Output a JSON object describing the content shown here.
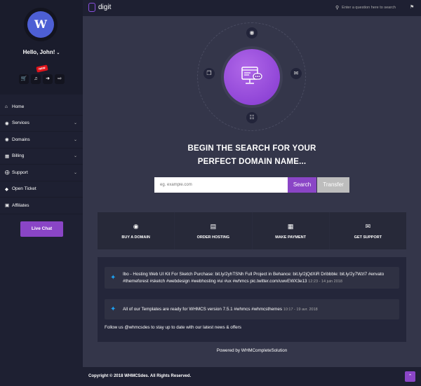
{
  "brand": {
    "logo_text": "digit",
    "accent": "#8a45c6"
  },
  "user": {
    "avatar_letter": "W",
    "greeting": "Hello, John!"
  },
  "quick_icons": [
    {
      "icon": "cart-icon"
    },
    {
      "icon": "bell-icon"
    },
    {
      "icon": "arrow-right-icon"
    },
    {
      "icon": "logout-icon"
    }
  ],
  "new_badge": "new",
  "sidebar": {
    "items": [
      {
        "label": "Home",
        "icon": "home-icon",
        "has_submenu": false
      },
      {
        "label": "Services",
        "icon": "cube-icon",
        "has_submenu": true
      },
      {
        "label": "Domains",
        "icon": "globe-icon",
        "has_submenu": true
      },
      {
        "label": "Billing",
        "icon": "card-icon",
        "has_submenu": true
      },
      {
        "label": "Support",
        "icon": "lifebuoy-icon",
        "has_submenu": true
      },
      {
        "label": "Open Ticket",
        "icon": "tag-icon",
        "has_submenu": false
      },
      {
        "label": "Affiliates",
        "icon": "affiliate-icon",
        "has_submenu": false
      }
    ],
    "live_chat": "Live Chat"
  },
  "topbar": {
    "search_placeholder": "Enter a question here to search"
  },
  "hero": {
    "headline_line1": "BEGIN THE SEARCH FOR YOUR",
    "headline_line2": "PERFECT DOMAIN NAME..."
  },
  "domain_search": {
    "placeholder": "eg. example.com",
    "search_label": "Search",
    "transfer_label": "Transfer"
  },
  "actions": [
    {
      "label": "BUY A DOMAIN",
      "icon": "globe-icon"
    },
    {
      "label": "ORDER HOSTING",
      "icon": "server-icon"
    },
    {
      "label": "MAKE PAYMENT",
      "icon": "card-icon"
    },
    {
      "label": "GET SUPPORT",
      "icon": "envelope-icon"
    }
  ],
  "tweets": [
    {
      "text": "Ibo - Hosting Web UI Kit For Sketch Purchase: bit.ly/2yhTSNh Full Project in Behance: bit.ly/2jQdXiR Dribbble: bit.ly/2y7Wzl7 #envato #themeforest #sketch #webdesign #webhosting #ui #ux #whmcs pic.twitter.com/uwvEWX3e13",
      "date": "12:23 - 14 juin 2018"
    },
    {
      "text": "All of our Templates are ready for WHMCS version 7.5.1 #whmcs #whmcsthemes",
      "date": "10:17 - 19 avr. 2018"
    }
  ],
  "follow_text": "Follow us @whmcsdes to stay up to date with our latest news & offers",
  "powered_by": "Powered by WHMCompleteSolution",
  "copyright": "Copyright © 2018 WHMCSdes. All Rights Reserved."
}
